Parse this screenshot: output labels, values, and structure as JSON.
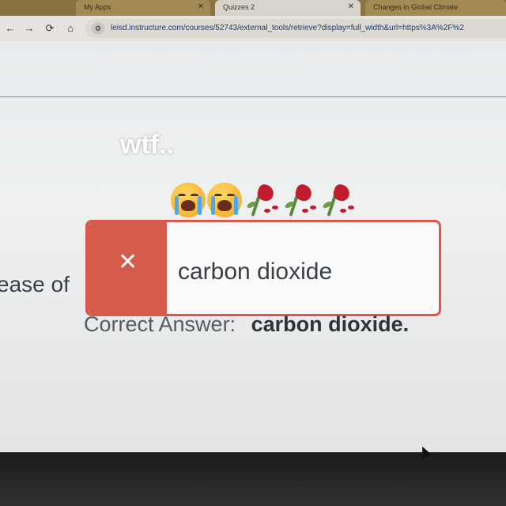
{
  "browser": {
    "tabs": [
      {
        "title": "My Apps",
        "active": false
      },
      {
        "title": "Quizzes 2",
        "active": true
      },
      {
        "title": "Changes in Global Climate",
        "active": false
      }
    ],
    "close_glyph": "✕",
    "nav": {
      "back": "←",
      "forward": "→",
      "reload": "⟳",
      "home": "⌂"
    },
    "url": "leisd.instructure.com/courses/52743/external_tools/retrieve?display=full_width&url=https%3A%2F%2"
  },
  "overlay": {
    "caption": "wtf.."
  },
  "question": {
    "partial_text": "ease of",
    "submitted_answer": "carbon dioxide",
    "status_icon": "x-icon",
    "correct_label": "Correct Answer:",
    "correct_value": "carbon dioxide."
  },
  "colors": {
    "incorrect": "#d45a49",
    "border": "#d9594c"
  }
}
